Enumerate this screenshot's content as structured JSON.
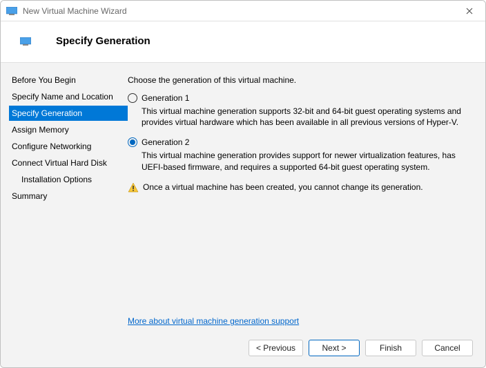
{
  "window": {
    "title": "New Virtual Machine Wizard"
  },
  "header": {
    "title": "Specify Generation"
  },
  "sidebar": {
    "items": [
      {
        "label": "Before You Begin"
      },
      {
        "label": "Specify Name and Location"
      },
      {
        "label": "Specify Generation"
      },
      {
        "label": "Assign Memory"
      },
      {
        "label": "Configure Networking"
      },
      {
        "label": "Connect Virtual Hard Disk"
      },
      {
        "label": "Installation Options"
      },
      {
        "label": "Summary"
      }
    ]
  },
  "content": {
    "intro": "Choose the generation of this virtual machine.",
    "gen1_label": "Generation 1",
    "gen1_desc": "This virtual machine generation supports 32-bit and 64-bit guest operating systems and provides virtual hardware which has been available in all previous versions of Hyper-V.",
    "gen2_label": "Generation 2",
    "gen2_desc": "This virtual machine generation provides support for newer virtualization features, has UEFI-based firmware, and requires a supported 64-bit guest operating system.",
    "warning": "Once a virtual machine has been created, you cannot change its generation.",
    "link": "More about virtual machine generation support"
  },
  "footer": {
    "previous": "< Previous",
    "next": "Next >",
    "finish": "Finish",
    "cancel": "Cancel"
  }
}
